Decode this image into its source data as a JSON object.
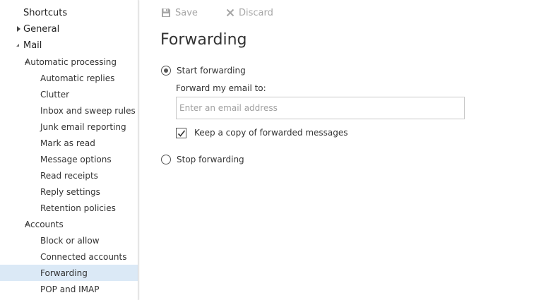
{
  "sidebar": {
    "items": [
      {
        "label": "Shortcuts",
        "level": 0,
        "expander": "none"
      },
      {
        "label": "General",
        "level": 0,
        "expander": "collapsed"
      },
      {
        "label": "Mail",
        "level": 0,
        "expander": "expanded"
      },
      {
        "label": "Automatic processing",
        "level": 1,
        "expander": "expanded"
      },
      {
        "label": "Automatic replies",
        "level": 2,
        "expander": "none"
      },
      {
        "label": "Clutter",
        "level": 2,
        "expander": "none"
      },
      {
        "label": "Inbox and sweep rules",
        "level": 2,
        "expander": "none"
      },
      {
        "label": "Junk email reporting",
        "level": 2,
        "expander": "none"
      },
      {
        "label": "Mark as read",
        "level": 2,
        "expander": "none"
      },
      {
        "label": "Message options",
        "level": 2,
        "expander": "none"
      },
      {
        "label": "Read receipts",
        "level": 2,
        "expander": "none"
      },
      {
        "label": "Reply settings",
        "level": 2,
        "expander": "none"
      },
      {
        "label": "Retention policies",
        "level": 2,
        "expander": "none"
      },
      {
        "label": "Accounts",
        "level": 1,
        "expander": "expanded"
      },
      {
        "label": "Block or allow",
        "level": 2,
        "expander": "none"
      },
      {
        "label": "Connected accounts",
        "level": 2,
        "expander": "none"
      },
      {
        "label": "Forwarding",
        "level": 2,
        "expander": "none",
        "selected": true
      },
      {
        "label": "POP and IMAP",
        "level": 2,
        "expander": "none"
      }
    ]
  },
  "toolbar": {
    "save_label": "Save",
    "discard_label": "Discard",
    "save_icon": "floppy-disk-icon",
    "discard_icon": "x-icon"
  },
  "page": {
    "title": "Forwarding",
    "start_forwarding_label": "Start forwarding",
    "start_forwarding_selected": true,
    "forward_to_label": "Forward my email to:",
    "email_placeholder": "Enter an email address",
    "email_value": "",
    "keep_copy_label": "Keep a copy of forwarded messages",
    "keep_copy_checked": true,
    "stop_forwarding_label": "Stop forwarding",
    "stop_forwarding_selected": false
  },
  "colors": {
    "selected_bg": "#dbe9f6",
    "toolbar_disabled": "#a6a6a6",
    "text": "#333333"
  }
}
